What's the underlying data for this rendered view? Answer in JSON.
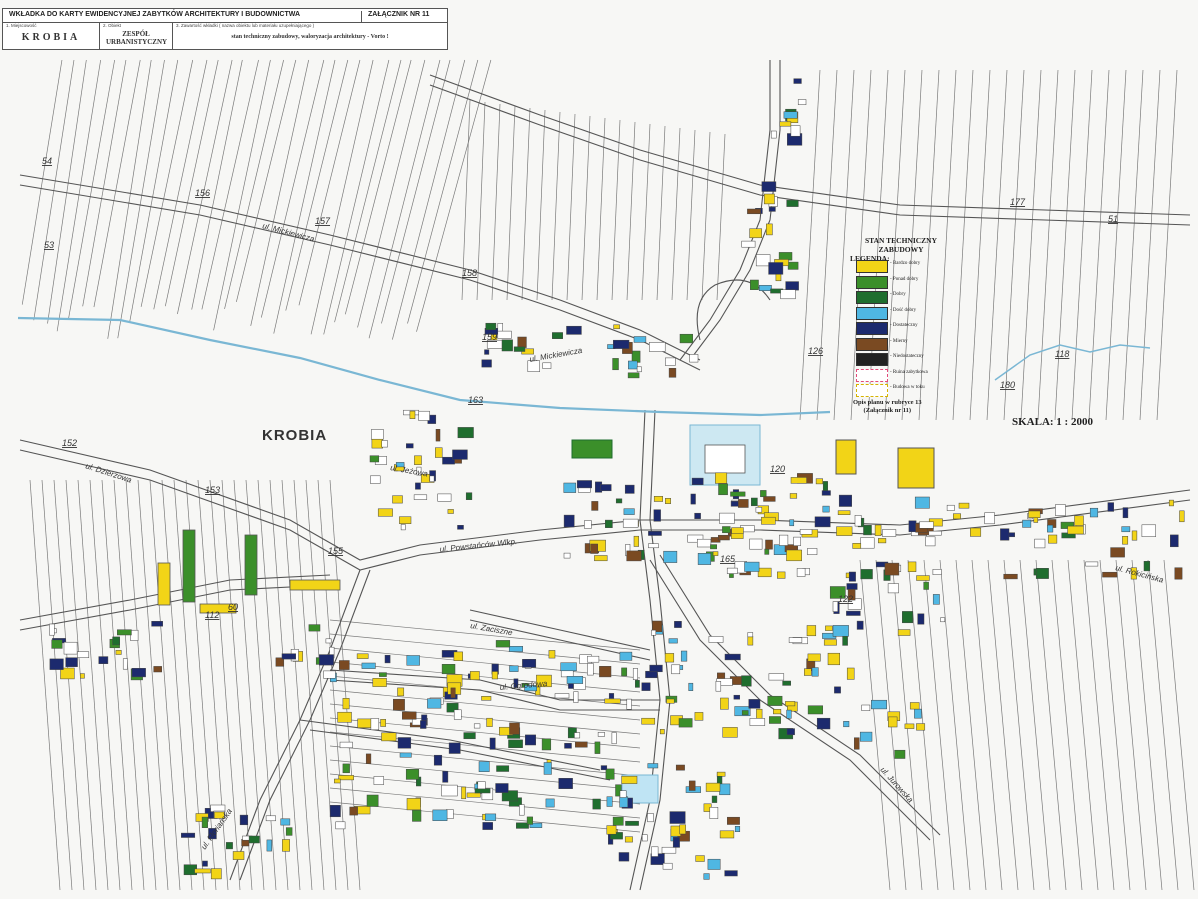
{
  "header": {
    "title": "WKŁADKA DO KARTY EWIDENCYJNEJ ZABYTKÓW ARCHITEKTURY I BUDOWNICTWA",
    "annex": "ZAŁĄCZNIK NR 11",
    "field1_label": "1. Miejscowość",
    "field1_value": "KROBIA",
    "field2_label": "2. Obiekt",
    "field2_value": "ZESPÓŁ URBANISTYCZNY",
    "field3_label": "3. Zawartość wkładki ( nazwa obiektu lub materiału uzupełniającego )",
    "field3_value": "stan techniczny zabudowy, waloryzacja architektury - Vorto !"
  },
  "legend": {
    "title_line1": "STAN TECHNICZNY ZABUDOWY",
    "title_line2": "LEGENDA:",
    "items": [
      {
        "label": "- Bardzo dobry",
        "color": "#f2d417"
      },
      {
        "label": "- Ponad dobry",
        "color": "#3b8f2a"
      },
      {
        "label": "- Dobry",
        "color": "#1f6e2e"
      },
      {
        "label": "- Dość dobry",
        "color": "#4fb7e3"
      },
      {
        "label": "- Dostateczny",
        "color": "#1c2a6e"
      },
      {
        "label": "- Mierny",
        "color": "#7a4a22"
      },
      {
        "label": "- Niedostateczny",
        "color": "#222222"
      },
      {
        "label": "- Ruina zabytkowa",
        "color": "#ffffff"
      },
      {
        "label": "- Budowa w toku",
        "color": "#ffffff"
      }
    ]
  },
  "note": {
    "line1": "Opis planu w rubryce 13",
    "line2": "(Załącznik nr 11)"
  },
  "scale": "SKALA: 1 : 2000",
  "town_label": "KROBIA",
  "streets": [
    "ul. Mickiewicza",
    "ul. Mickiewicza",
    "ul. Dzierżowa",
    "ul. Jeżowa",
    "ul. Powstańców Wlkp.",
    "ul. Zaciszne",
    "ul. Ogrodowa",
    "ul. Rokicińska",
    "ul. Jurowska",
    "ul. Floriańska"
  ],
  "parcel_numbers": [
    "152",
    "153",
    "54",
    "53",
    "156",
    "157",
    "158",
    "159",
    "155",
    "163",
    "165",
    "120",
    "122",
    "126",
    "118",
    "180",
    "177",
    "51",
    "112",
    "60"
  ],
  "colors": {
    "paper": "#f7f7f5",
    "line": "#6a6a6a",
    "river": "#7ab7d4"
  }
}
